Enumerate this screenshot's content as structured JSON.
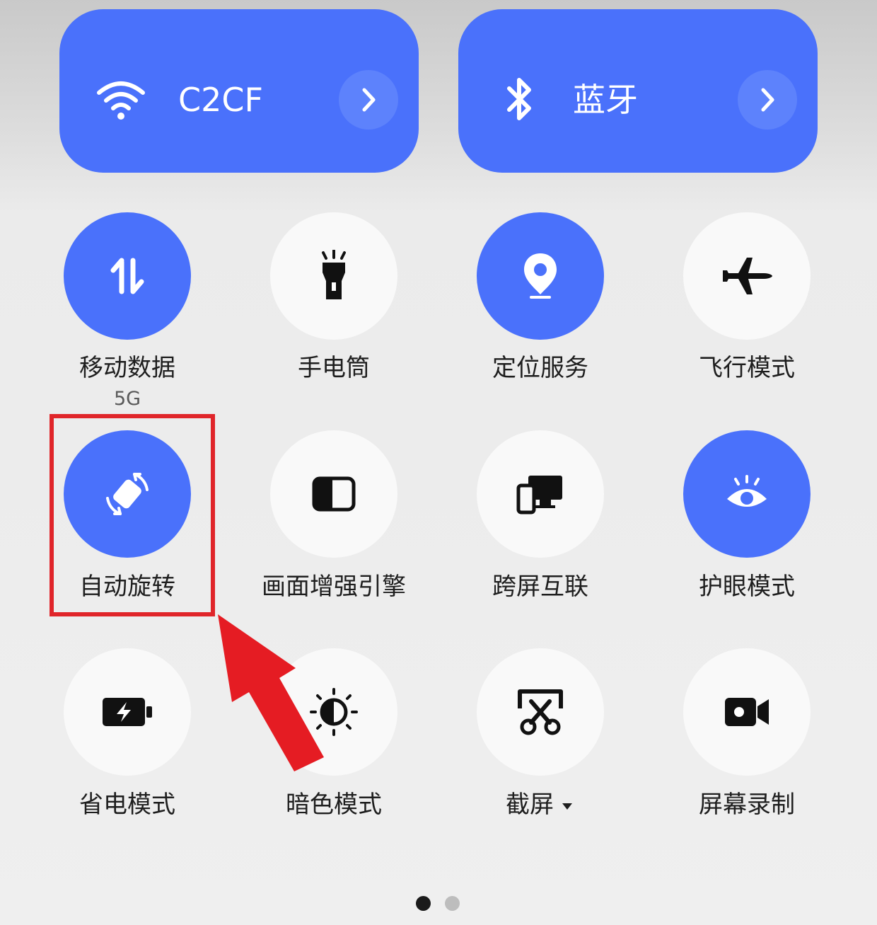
{
  "big_tiles": {
    "wifi": {
      "label": "C2CF",
      "icon": "wifi-icon"
    },
    "bluetooth": {
      "label": "蓝牙",
      "icon": "bluetooth-icon"
    }
  },
  "tiles": [
    {
      "label": "移动数据",
      "sublabel": "5G",
      "icon": "data-arrows-icon",
      "state": "on"
    },
    {
      "label": "手电筒",
      "icon": "flashlight-icon",
      "state": "off"
    },
    {
      "label": "定位服务",
      "icon": "location-pin-icon",
      "state": "on"
    },
    {
      "label": "飞行模式",
      "icon": "airplane-icon",
      "state": "off"
    },
    {
      "label": "自动旋转",
      "icon": "auto-rotate-icon",
      "state": "on"
    },
    {
      "label": "画面增强引擎",
      "icon": "display-enhance-icon",
      "state": "off"
    },
    {
      "label": "跨屏互联",
      "icon": "multi-screen-icon",
      "state": "off"
    },
    {
      "label": "护眼模式",
      "icon": "eye-icon",
      "state": "on"
    },
    {
      "label": "省电模式",
      "icon": "battery-saver-icon",
      "state": "off"
    },
    {
      "label": "暗色模式",
      "icon": "dark-mode-icon",
      "state": "off"
    },
    {
      "label": "截屏",
      "icon": "screenshot-icon",
      "state": "off",
      "has_dropdown": true
    },
    {
      "label": "屏幕录制",
      "icon": "screen-record-icon",
      "state": "off"
    }
  ],
  "pagination": {
    "total": 2,
    "current": 1
  },
  "colors": {
    "accent": "#4a71fb",
    "tile_off": "#f9f9f9",
    "annotation": "#e0252a"
  }
}
